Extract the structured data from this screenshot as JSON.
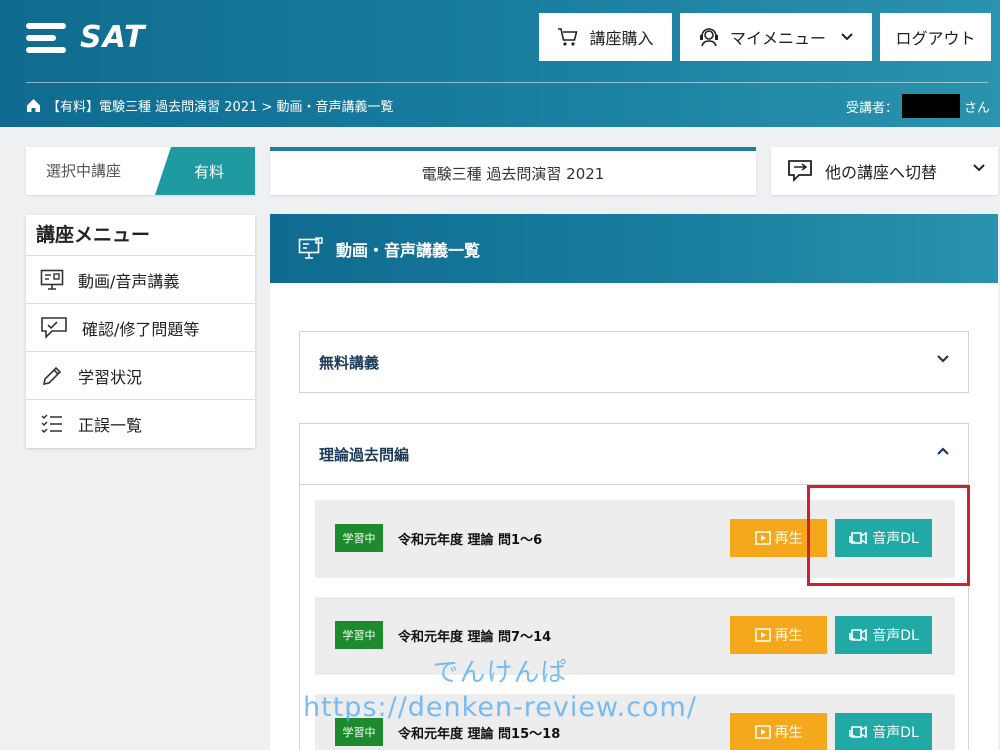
{
  "header": {
    "logo_text": "SAT",
    "buy_label": "講座購入",
    "mymenu_label": "マイメニュー",
    "logout_label": "ログアウト",
    "breadcrumb": "【有料】電験三種 過去問演習 2021 > 動画・音声講義一覧",
    "user_prefix": "受講者：",
    "user_suffix": "さん"
  },
  "course_bar": {
    "selected_label": "選択中講座",
    "selected_tag": "有料",
    "course_title": "電験三種 過去問演習 2021",
    "switch_label": "他の講座へ切替"
  },
  "sidebar": {
    "title": "講座メニュー",
    "items": [
      {
        "label": "動画/音声講義",
        "icon": "video-lecture-icon"
      },
      {
        "label": "確認/修了問題等",
        "icon": "chat-check-icon"
      },
      {
        "label": "学習状況",
        "icon": "pencil-icon"
      },
      {
        "label": "正誤一覧",
        "icon": "checklist-icon"
      }
    ]
  },
  "main": {
    "title": "動画・音声講義一覧",
    "sections": [
      {
        "title": "無料講義",
        "expanded": false
      },
      {
        "title": "理論過去問編",
        "expanded": true
      }
    ],
    "lectures": [
      {
        "status": "学習中",
        "title": "令和元年度 理論 問1〜6",
        "play_label": "再生",
        "dl_label": "音声DL"
      },
      {
        "status": "学習中",
        "title": "令和元年度 理論 問7〜14",
        "play_label": "再生",
        "dl_label": "音声DL"
      },
      {
        "status": "学習中",
        "title": "令和元年度 理論 問15〜18",
        "play_label": "再生",
        "dl_label": "音声DL"
      }
    ]
  },
  "watermark": {
    "line1": "でんけんぱ",
    "line2": "https://denken-review.com/"
  },
  "colors": {
    "header_teal": "#1a7fa0",
    "tag_teal": "#1e9aa0",
    "play_orange": "#f5a81c",
    "dl_teal": "#20a9a5",
    "badge_green": "#1e8a2e",
    "highlight_red": "#d0202c"
  }
}
